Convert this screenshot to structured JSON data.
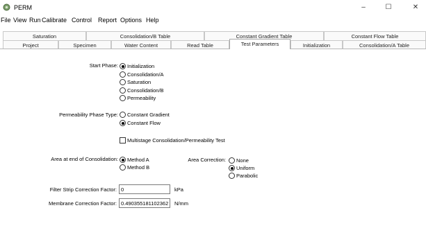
{
  "window": {
    "title": "PERM",
    "minimize": "–",
    "maximize": "☐",
    "close": "✕"
  },
  "menu": [
    "File",
    "View",
    "Run",
    "Calibrate",
    "Control",
    "Report",
    "Options",
    "Help"
  ],
  "tabs_row1": [
    "Saturation",
    "Consolidation/B Table",
    "Constant Gradient Table",
    "Constant Flow Table"
  ],
  "tabs_row2": [
    "Project",
    "Specimen",
    "Water Content",
    "Read Table",
    "Test Parameters",
    "Initialization",
    "Consolidation/A Table"
  ],
  "active_tab": "Test Parameters",
  "start_phase": {
    "label": "Start Phase:",
    "options": [
      "Initialization",
      "Consolidation/A",
      "Saturation",
      "Consolidation/B",
      "Permeability"
    ],
    "selected": "Initialization"
  },
  "permeability_phase": {
    "label": "Permeability Phase Type:",
    "options": [
      "Constant Gradient",
      "Constant Flow"
    ],
    "selected": "Constant Flow"
  },
  "multistage": {
    "label": "Multistage Consolidation/Permeability Test",
    "checked": false
  },
  "area_end": {
    "label": "Area at end of Consolidation:",
    "options": [
      "Method A",
      "Method B"
    ],
    "selected": "Method A"
  },
  "area_correction": {
    "label": "Area Correction:",
    "options": [
      "None",
      "Uniform",
      "Parabolic"
    ],
    "selected": "Uniform"
  },
  "filter_strip": {
    "label": "Filter Strip Correction Factor:",
    "value": "0",
    "unit": "kPa"
  },
  "membrane": {
    "label": "Membrane Correction Factor:",
    "value": "0.490355181102362",
    "unit": "N/mm"
  }
}
